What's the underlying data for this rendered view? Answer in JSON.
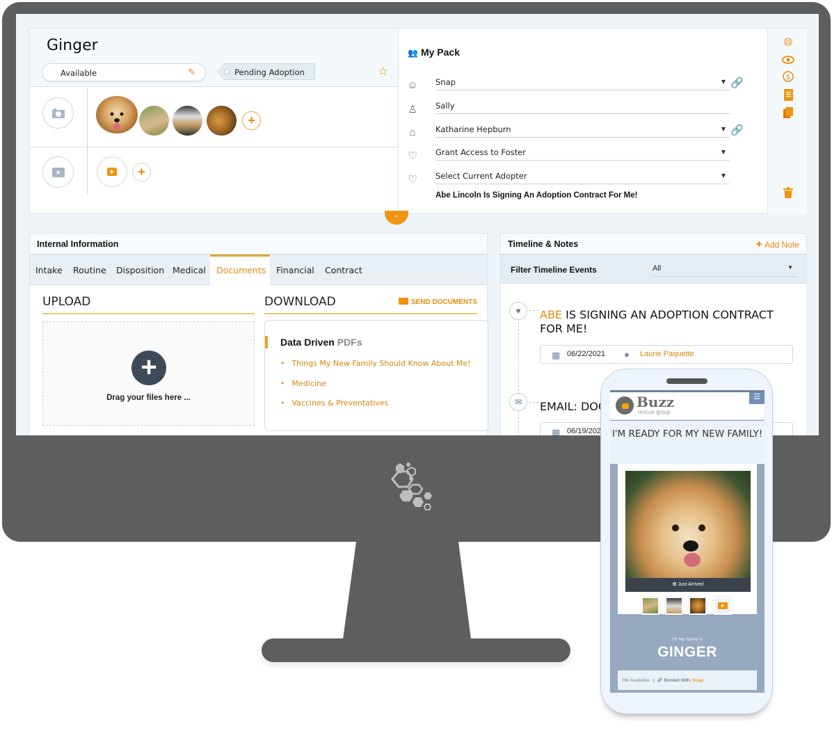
{
  "profile": {
    "pet_name": "Ginger",
    "status": "Available",
    "pending_tag": "Pending Adoption",
    "photos_count": 4,
    "videos_count": 1
  },
  "pack": {
    "title": "My Pack",
    "rows": [
      {
        "icon": "dog-icon",
        "value": "Snap",
        "dropdown": true,
        "linked": true
      },
      {
        "icon": "person-icon",
        "value": "Sally",
        "dropdown": false,
        "linked": false
      },
      {
        "icon": "home-heart-icon",
        "value": "Katharine Hepburn",
        "dropdown": true,
        "linked": true
      },
      {
        "icon": "hand-heart-icon",
        "value": "Grant Access to Foster",
        "dropdown": true,
        "linked": false
      },
      {
        "icon": "heart-icon",
        "value": "Select Current Adopter",
        "dropdown": true,
        "linked": false
      }
    ],
    "note": "Abe Lincoln Is Signing An Adoption Contract For Me!"
  },
  "side_icons": [
    "globe-icon",
    "eye-icon",
    "dollar-icon",
    "document-icon",
    "copy-icon",
    "trash-icon"
  ],
  "internal": {
    "title": "Internal Information",
    "tabs": [
      "Intake",
      "Routine",
      "Disposition",
      "Medical",
      "Documents",
      "Financial",
      "Contract"
    ],
    "active_tab": "Documents",
    "upload": {
      "title": "UPLOAD",
      "drop_text": "Drag your files here ..."
    },
    "download": {
      "title": "DOWNLOAD",
      "send_label": "SEND DOCUMENTS",
      "heading_bold": "Data Driven",
      "heading_muted": "PDFs",
      "items": [
        "Things My New Family Should Know About Me!",
        "Medicine",
        "Vaccines & Preventatives"
      ]
    }
  },
  "timeline": {
    "title": "Timeline & Notes",
    "add_note": "Add Note",
    "filter_label": "Filter Timeline Events",
    "filter_value": "All",
    "events": [
      {
        "highlight": "ABE",
        "title": " IS SIGNING AN ADOPTION CONTRACT FOR ME!",
        "date": "06/22/2021",
        "user": "Laurie Paquette"
      },
      {
        "highlight": "",
        "title": "EMAIL: DOC",
        "date": "06/19/2021",
        "user": ""
      }
    ]
  },
  "phone": {
    "brand": "Buzz",
    "brand_sub": "rescue group",
    "hero": "I'M READY FOR MY NEW FAMILY!",
    "badge": "Just Arrived",
    "greeting": "Hi! My Name is",
    "name": "GINGER",
    "status_prefix": "I'm",
    "status_value": "Available",
    "bonded_label": "Bonded With:",
    "bonded_value": "Snap"
  },
  "colors": {
    "accent": "#e88a0c",
    "monitor": "#5e5e5e",
    "phone_bg": "#96a9c0"
  }
}
